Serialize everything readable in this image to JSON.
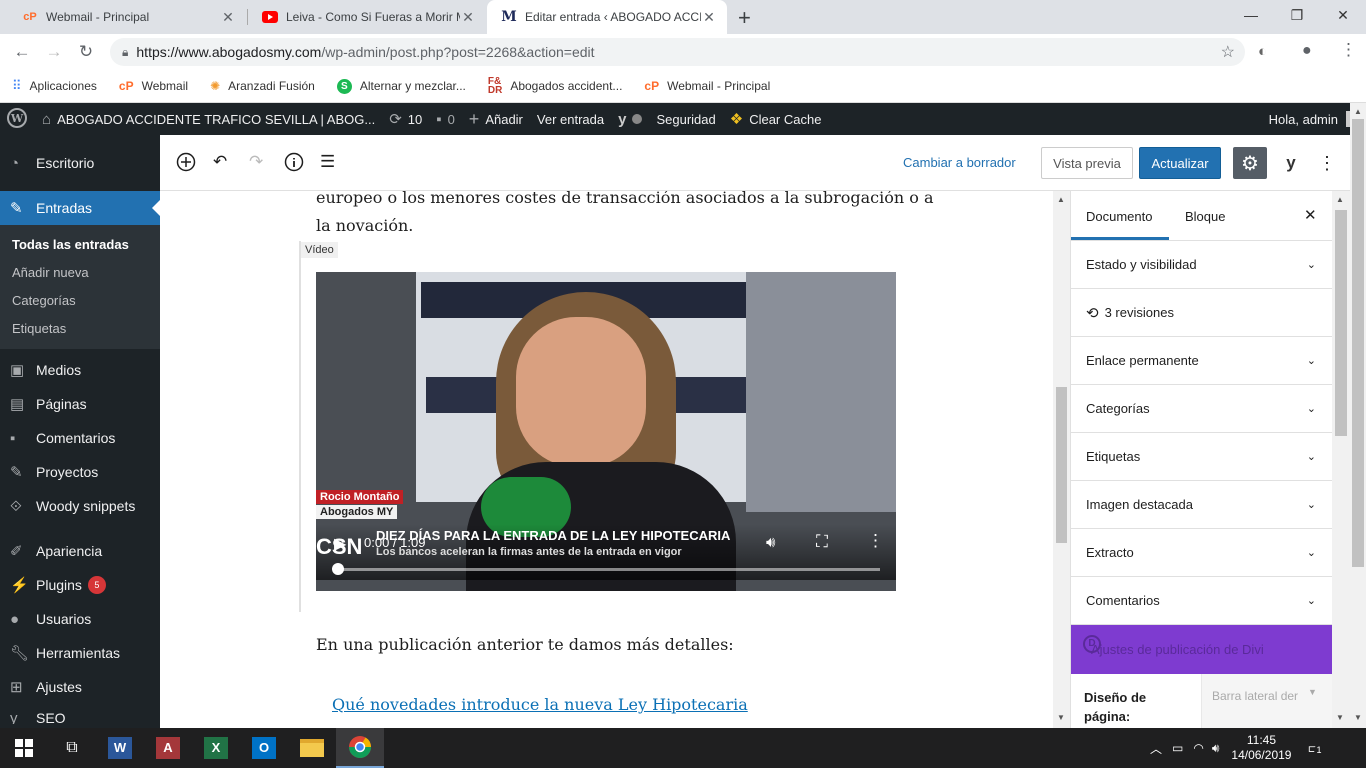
{
  "browser": {
    "tabs": [
      {
        "title": "Webmail - Principal",
        "favicon": "cpanel-icon"
      },
      {
        "title": "Leiva - Como Si Fueras a Morir M",
        "favicon": "youtube-icon"
      },
      {
        "title": "Editar entrada ‹ ABOGADO ACCIDE",
        "favicon": "abogadosmy-icon"
      }
    ],
    "new_tab": "+",
    "url_host": "https://www.abogadosmy.com",
    "url_path": "/wp-admin/post.php?post=2268&action=edit",
    "bookmarks": [
      {
        "label": "Aplicaciones",
        "icon": "apps-grid-icon"
      },
      {
        "label": "Webmail",
        "icon": "cpanel-icon"
      },
      {
        "label": "Aranzadi Fusión",
        "icon": "aranzadi-icon"
      },
      {
        "label": "Alternar y mezclar...",
        "icon": "s-green-icon"
      },
      {
        "label": "Abogados accident...",
        "icon": "fdr-icon"
      },
      {
        "label": "Webmail - Principal",
        "icon": "cpanel-icon"
      }
    ]
  },
  "adminbar": {
    "site": "ABOGADO ACCIDENTE TRAFICO SEVILLA | ABOG...",
    "updates": "10",
    "comments": "0",
    "add": "Añadir",
    "view": "Ver entrada",
    "security": "Seguridad",
    "cache": "Clear Cache",
    "greeting": "Hola, admin"
  },
  "sidebar": {
    "items": [
      {
        "label": "Escritorio",
        "icon": "dashboard-icon"
      },
      {
        "label": "Entradas",
        "icon": "pin-icon"
      },
      {
        "label": "Medios",
        "icon": "media-icon"
      },
      {
        "label": "Páginas",
        "icon": "pages-icon"
      },
      {
        "label": "Comentarios",
        "icon": "comments-icon"
      },
      {
        "label": "Proyectos",
        "icon": "pin-icon"
      },
      {
        "label": "Woody snippets",
        "icon": "snippets-icon"
      },
      {
        "label": "Apariencia",
        "icon": "brush-icon"
      },
      {
        "label": "Plugins",
        "icon": "plugin-icon",
        "badge": "5"
      },
      {
        "label": "Usuarios",
        "icon": "users-icon"
      },
      {
        "label": "Herramientas",
        "icon": "wrench-icon"
      },
      {
        "label": "Ajustes",
        "icon": "settings-icon"
      },
      {
        "label": "SEO",
        "icon": "seo-icon"
      }
    ],
    "submenu": [
      "Todas las entradas",
      "Añadir nueva",
      "Categorías",
      "Etiquetas"
    ]
  },
  "editor": {
    "switch_draft": "Cambiar a borrador",
    "preview": "Vista previa",
    "update": "Actualizar",
    "para1_line1": "europeo o los menores costes de transacción asociados a la subrogación o a",
    "para1_line2": "la novación.",
    "block_label": "Vídeo",
    "video_time": "0:00 / 1:09",
    "video_progress": 0.0,
    "video_caption_name": "Rocio Montaño",
    "video_caption_org": "Abogados MY",
    "video_headline": "DIEZ DÍAS PARA LA ENTRADA DE LA LEY HIPOTECARIA",
    "video_subheadline": "Los bancos aceleran la firmas antes de la entrada en vigor",
    "video_channel": "CSN",
    "para2": "En una publicación anterior te damos más detalles:",
    "link": "Qué novedades introduce la nueva Ley Hipotecaria"
  },
  "panel": {
    "tab_document": "Documento",
    "tab_block": "Bloque",
    "sections": [
      "Estado y visibilidad",
      "3 revisiones",
      "Enlace permanente",
      "Categorías",
      "Etiquetas",
      "Imagen destacada",
      "Extracto",
      "Comentarios"
    ],
    "divi_title": "Ajustes de publicación de Divi",
    "layout_label": "Diseño de página:",
    "layout_value": "Barra lateral der"
  },
  "taskbar": {
    "time": "11:45",
    "date": "14/06/2019",
    "notifications": "1"
  },
  "colors": {
    "wp_dark": "#1d2327",
    "wp_blue": "#2271b1",
    "divi_purple": "#7e3bd0",
    "badge_red": "#d63638"
  }
}
